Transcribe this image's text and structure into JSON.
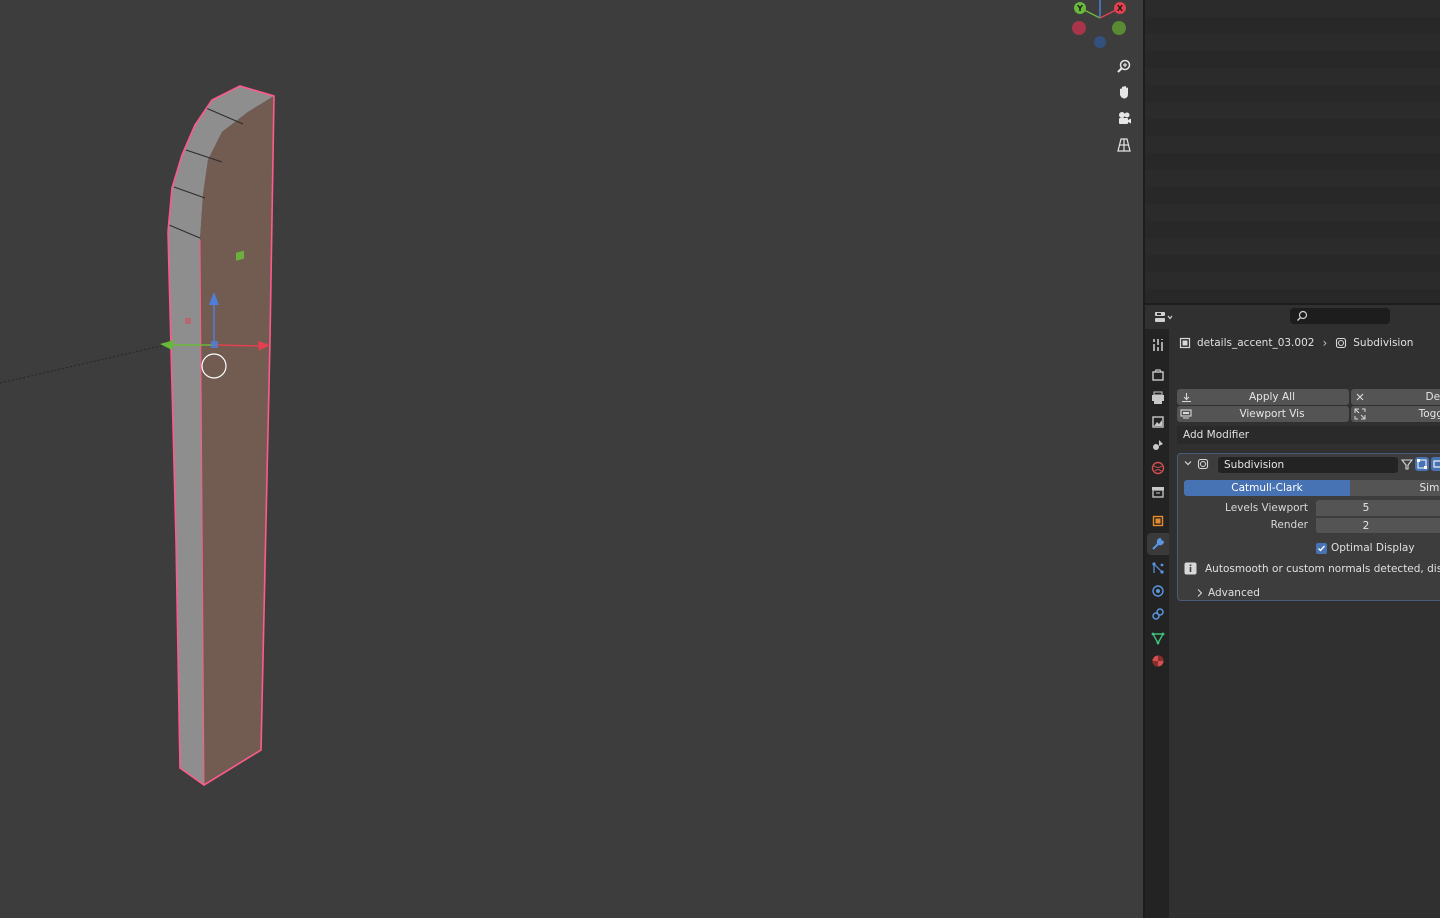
{
  "properties": {
    "breadcrumb": {
      "object_name": "details_accent_03.002",
      "modifier_name": "Subdivision"
    },
    "toolbar": {
      "apply_all": "Apply All",
      "delete_all": "Del",
      "viewport_vis": "Viewport Vis",
      "toggle_stack": "Togg"
    },
    "add_modifier_label": "Add Modifier",
    "modifier": {
      "name": "Subdivision",
      "method_catmull": "Catmull-Clark",
      "method_simple": "Simp",
      "levels_viewport_label": "Levels Viewport",
      "levels_viewport_value": "5",
      "render_label": "Render",
      "render_value": "2",
      "optimal_display_label": "Optimal Display",
      "optimal_display_checked": true,
      "info_message": "Autosmooth or custom normals detected, disablin",
      "advanced_label": "Advanced"
    },
    "tabs": [
      {
        "name": "tool-tab-icon",
        "color": "#c8c8c8"
      },
      {
        "name": "render-tab-icon",
        "color": "#c8c8c8"
      },
      {
        "name": "output-tab-icon",
        "color": "#c8c8c8"
      },
      {
        "name": "view-layer-tab-icon",
        "color": "#c8c8c8"
      },
      {
        "name": "scene-tab-icon",
        "color": "#c8c8c8"
      },
      {
        "name": "world-tab-icon",
        "color": "#d25050"
      },
      {
        "name": "collection-tab-icon",
        "color": "#c8c8c8"
      },
      {
        "name": "object-tab-icon",
        "color": "#e48a2c"
      },
      {
        "name": "modifier-tab-icon",
        "color": "#5a95e0"
      },
      {
        "name": "particles-tab-icon",
        "color": "#5a95e0"
      },
      {
        "name": "physics-tab-icon",
        "color": "#5a95e0"
      },
      {
        "name": "constraints-tab-icon",
        "color": "#5a95e0"
      },
      {
        "name": "data-tab-icon",
        "color": "#3fc27a"
      },
      {
        "name": "material-tab-icon",
        "color": "#d25050"
      }
    ]
  },
  "colors": {
    "accent_blue": "#4772b3",
    "selection_outline": "#ff5a8a",
    "viewport_bg": "#3d3d3d",
    "axis_x": "#e04050",
    "axis_y": "#6ab83a",
    "axis_z": "#4f7ed8"
  }
}
